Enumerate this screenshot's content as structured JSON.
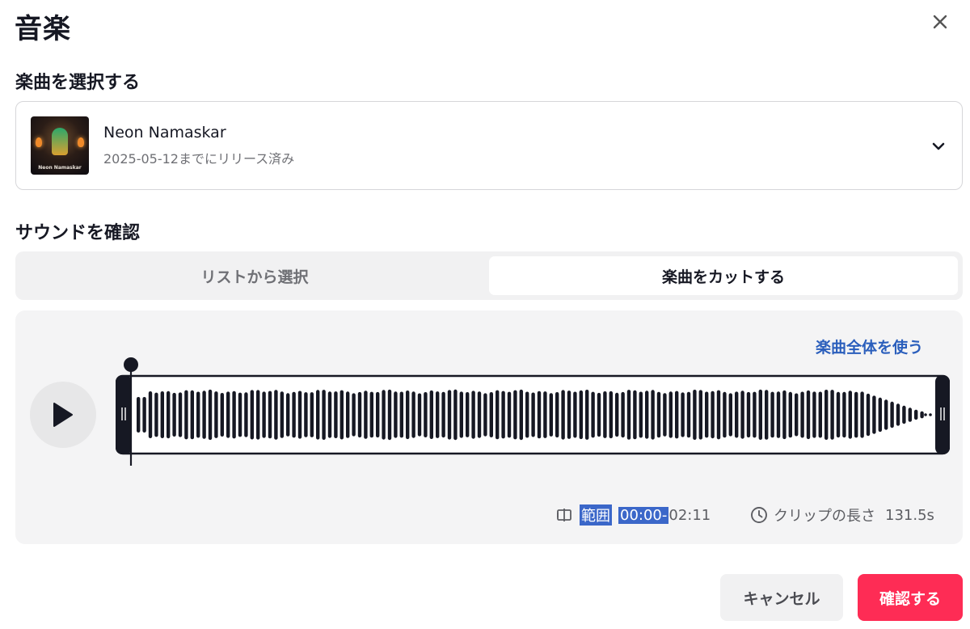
{
  "dialog": {
    "title": "音楽"
  },
  "select_section": {
    "label": "楽曲を選択する"
  },
  "track": {
    "name": "Neon Namaskar",
    "subtitle": "2025-05-12までにリリース済み",
    "cover_caption": "Neon Namaskar"
  },
  "review_section": {
    "label": "サウンドを確認"
  },
  "tabs": [
    {
      "label": "リストから選択",
      "active": false
    },
    {
      "label": "楽曲をカットする",
      "active": true
    }
  ],
  "editor": {
    "use_full_label": "楽曲全体を使う",
    "range_label": "範囲",
    "range_start": "00:00-",
    "range_end": "02:11",
    "clip_label": "クリップの長さ",
    "clip_value": "131.5s",
    "playhead_position": 0
  },
  "actions": {
    "cancel_label": "キャンセル",
    "confirm_label": "確認する"
  },
  "colors": {
    "accent": "#fe2c55",
    "link": "#2a5ebc",
    "highlight": "#3b67c9"
  },
  "icons": [
    "close-icon",
    "chevron-down-icon",
    "play-icon",
    "range-icon",
    "clock-icon"
  ]
}
